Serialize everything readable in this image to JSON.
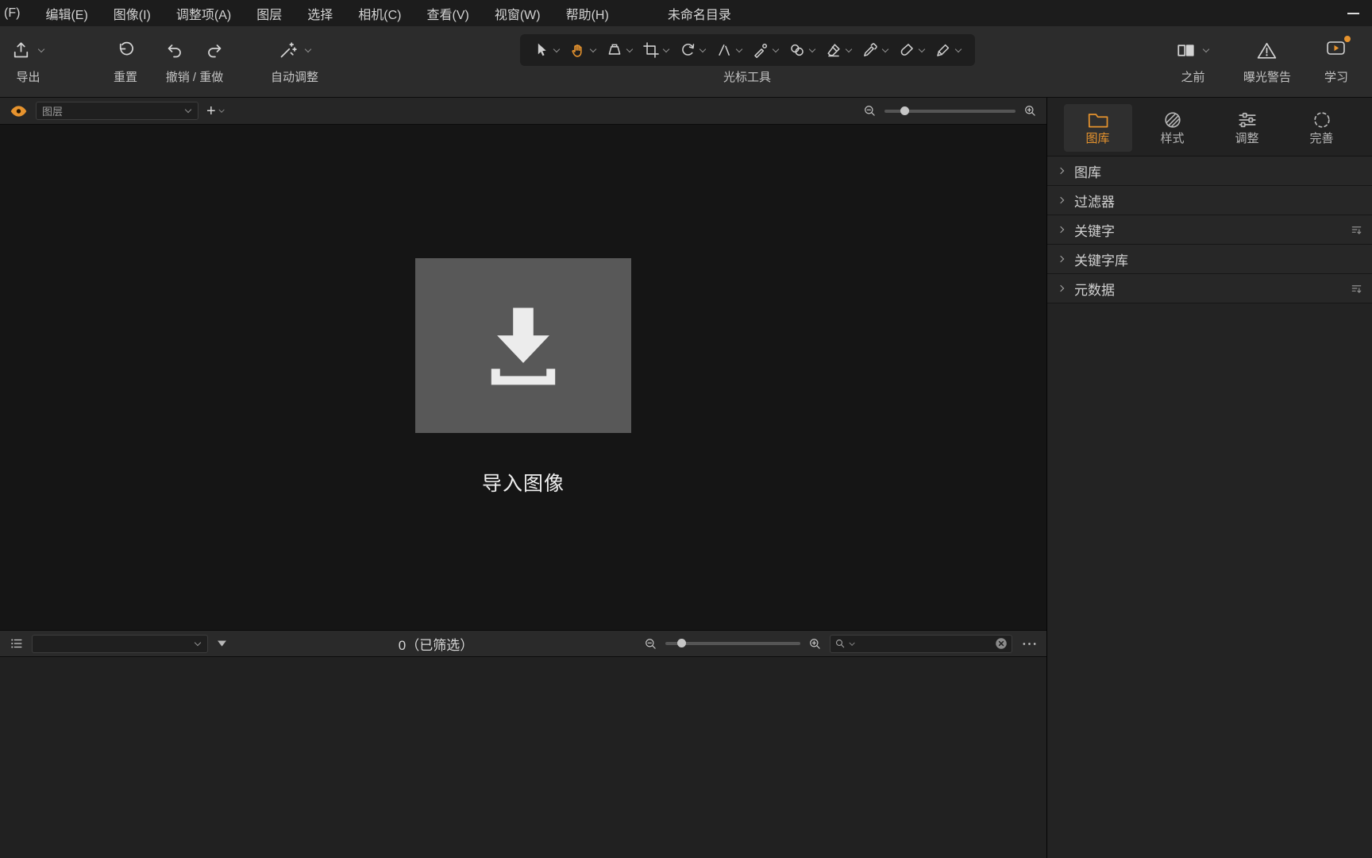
{
  "colors": {
    "accent": "#e6932e",
    "background": "#141414",
    "toolbar": "#2c2c2c"
  },
  "menubar": {
    "items": [
      "(F)",
      "编辑(E)",
      "图像(I)",
      "调整项(A)",
      "图层",
      "选择",
      "相机(C)",
      "查看(V)",
      "视窗(W)",
      "帮助(H)"
    ],
    "title": "未命名目录"
  },
  "toolbar": {
    "export_label": "导出",
    "reset_label": "重置",
    "undo_redo_label": "撤销 / 重做",
    "auto_adjust_label": "自动调整",
    "cursor_tools_label": "光标工具",
    "cursor_tools": [
      {
        "name": "pointer",
        "active": false
      },
      {
        "name": "hand",
        "active": true
      },
      {
        "name": "loupe",
        "active": false
      },
      {
        "name": "crop",
        "active": false
      },
      {
        "name": "rotate",
        "active": false
      },
      {
        "name": "straighten",
        "active": false
      },
      {
        "name": "heal",
        "active": false
      },
      {
        "name": "clone",
        "active": false
      },
      {
        "name": "erase",
        "active": false
      },
      {
        "name": "eyedropper",
        "active": false
      },
      {
        "name": "brush",
        "active": false
      },
      {
        "name": "pen",
        "active": false
      }
    ],
    "before_label": "之前",
    "exposure_warning_label": "曝光警告",
    "learn_label": "学习"
  },
  "viewer": {
    "layers_dropdown_value": "图层",
    "import_label": "导入图像"
  },
  "browser": {
    "count_label": "0（已筛选）",
    "search_value": ""
  },
  "right_panel": {
    "tabs": [
      {
        "id": "library",
        "icon": "folder",
        "label": "图库",
        "active": true
      },
      {
        "id": "styles",
        "icon": "styles",
        "label": "样式",
        "active": false
      },
      {
        "id": "adjust",
        "icon": "adjust",
        "label": "调整",
        "active": false
      },
      {
        "id": "refine",
        "icon": "refine",
        "label": "完善",
        "active": false
      }
    ],
    "sections": [
      {
        "id": "library",
        "label": "图库",
        "action": false
      },
      {
        "id": "filters",
        "label": "过滤器",
        "action": false
      },
      {
        "id": "keywords",
        "label": "关键字",
        "action": true
      },
      {
        "id": "keyword-library",
        "label": "关键字库",
        "action": false
      },
      {
        "id": "metadata",
        "label": "元数据",
        "action": true
      }
    ]
  }
}
